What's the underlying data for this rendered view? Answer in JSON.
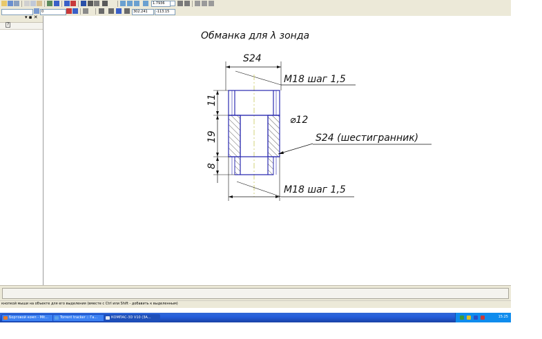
{
  "toolbar": {
    "zoom_value": "1.7936",
    "layer_value": "0",
    "coord_x": "302.241",
    "coord_y": "-113.15"
  },
  "side_panel": {
    "close_glyph": "▾ ▪ ✕",
    "help_glyph": "?"
  },
  "drawing": {
    "title": "Обманка для λ зонда",
    "dim_top": "S24",
    "thread_top": "M18 шаг 1,5",
    "dim_11": "11",
    "dim_19": "19",
    "dim_8": "8",
    "dia_12": "⌀12",
    "hex_label": "S24 (шестигранник)",
    "thread_bottom": "M18 шаг 1,5"
  },
  "status": {
    "hint": "кнопкой мыши на объекте для его выделения (вместе с Ctrl или Shift - добавить к выделенным)"
  },
  "taskbar": {
    "items": [
      {
        "label": "Бортовой комп - Mit...",
        "icon": "firefox-icon"
      },
      {
        "label": "Torrent tracker :: Га...",
        "icon": "browser-icon"
      },
      {
        "label": "КОМПАС-3D V10 (ЗА...",
        "icon": "kompas-icon"
      }
    ],
    "lang": "RU",
    "clock": "15:25"
  },
  "colors": {
    "outline": "#2a2ab0",
    "hatch": "#222222",
    "axis": "#c8c85a",
    "taskbar": "#245edc"
  }
}
